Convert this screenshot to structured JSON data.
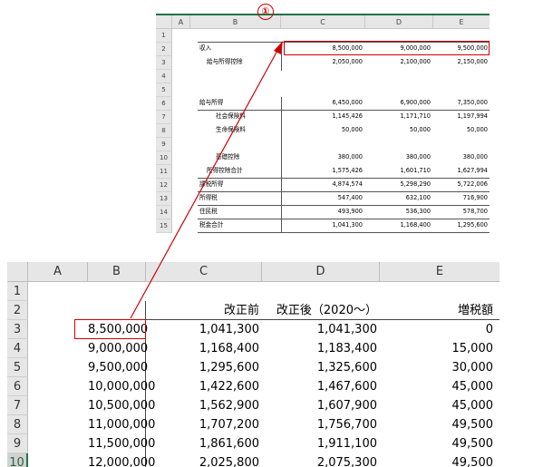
{
  "marker": "①",
  "top_sheet": {
    "columns": [
      "A",
      "B",
      "C",
      "D",
      "E"
    ],
    "rows": [
      "1",
      "2",
      "3",
      "4",
      "5",
      "6",
      "7",
      "8",
      "9",
      "10",
      "11",
      "12",
      "13",
      "14",
      "15"
    ],
    "labels": {
      "income": "収入",
      "salary_deduction": "給与所得控除",
      "salary_income": "給与所得",
      "social_insurance": "社会保険料",
      "life_insurance": "生命保険料",
      "basic_deduction": "基礎控除",
      "deduction_total": "所得控除合計",
      "taxable_income": "課税所得",
      "income_tax": "所得税",
      "resident_tax": "住民税",
      "tax_total": "税金合計"
    },
    "values": {
      "income": [
        "8,500,000",
        "9,000,000",
        "9,500,000"
      ],
      "salary_deduction": [
        "2,050,000",
        "2,100,000",
        "2,150,000"
      ],
      "salary_income": [
        "6,450,000",
        "6,900,000",
        "7,350,000"
      ],
      "social_insurance": [
        "1,145,426",
        "1,171,710",
        "1,197,994"
      ],
      "life_insurance": [
        "50,000",
        "50,000",
        "50,000"
      ],
      "basic_deduction": [
        "380,000",
        "380,000",
        "380,000"
      ],
      "deduction_total": [
        "1,575,426",
        "1,601,710",
        "1,627,994"
      ],
      "taxable_income": [
        "4,874,574",
        "5,298,290",
        "5,722,006"
      ],
      "income_tax": [
        "547,400",
        "632,100",
        "716,900"
      ],
      "resident_tax": [
        "493,900",
        "536,300",
        "578,700"
      ],
      "tax_total": [
        "1,041,300",
        "1,168,400",
        "1,295,600"
      ]
    }
  },
  "bottom_sheet": {
    "columns": [
      "A",
      "B",
      "C",
      "D",
      "E"
    ],
    "row_numbers": [
      "1",
      "2",
      "3",
      "4",
      "5",
      "6",
      "7",
      "8",
      "9",
      "10"
    ],
    "headers": {
      "before": "改正前",
      "after": "改正後（2020～）",
      "increase": "増税額"
    },
    "rows": [
      {
        "income": "8,500,000",
        "before": "1,041,300",
        "after": "1,041,300",
        "increase": "0"
      },
      {
        "income": "9,000,000",
        "before": "1,168,400",
        "after": "1,183,400",
        "increase": "15,000"
      },
      {
        "income": "9,500,000",
        "before": "1,295,600",
        "after": "1,325,600",
        "increase": "30,000"
      },
      {
        "income": "10,000,000",
        "before": "1,422,600",
        "after": "1,467,600",
        "increase": "45,000"
      },
      {
        "income": "10,500,000",
        "before": "1,562,900",
        "after": "1,607,900",
        "increase": "45,000"
      },
      {
        "income": "11,000,000",
        "before": "1,707,200",
        "after": "1,756,700",
        "increase": "49,500"
      },
      {
        "income": "11,500,000",
        "before": "1,861,600",
        "after": "1,911,100",
        "increase": "49,500"
      },
      {
        "income": "12,000,000",
        "before": "2,025,800",
        "after": "2,075,300",
        "increase": "49,500"
      }
    ]
  },
  "colors": {
    "highlight": "#d00000",
    "excel_green": "#217346"
  }
}
